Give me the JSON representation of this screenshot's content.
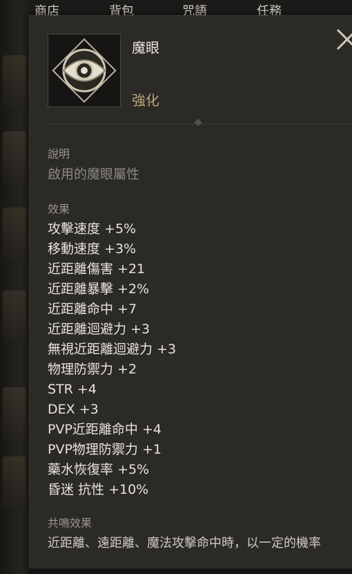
{
  "tabs": [
    "商店",
    "背包",
    "咒語",
    "任務"
  ],
  "item": {
    "name": "魔眼",
    "type": "強化",
    "icon": "magic-eye-icon"
  },
  "description": {
    "title": "說明",
    "text": "啟用的魔眼屬性"
  },
  "effects": {
    "title": "效果",
    "items": [
      "攻擊速度 +5%",
      "移動速度 +3%",
      "近距離傷害 +21",
      "近距離暴擊 +2%",
      "近距離命中 +7",
      "近距離迴避力 +3",
      "無視近距離迴避力 +3",
      "物理防禦力 +2",
      "STR +4",
      "DEX +3",
      "PVP近距離命中 +4",
      "PVP物理防禦力 +1",
      "藥水恢復率 +5%",
      "昏迷 抗性 +10%"
    ]
  },
  "resonance": {
    "title": "共鳴效果",
    "text": "近距離、遠距離、魔法攻擊命中時，以一定的機率"
  },
  "colors": {
    "panel": "#2b2a27",
    "accent_gold": "#b9a677",
    "muted": "#8b8880",
    "notification": "#e3261e"
  }
}
